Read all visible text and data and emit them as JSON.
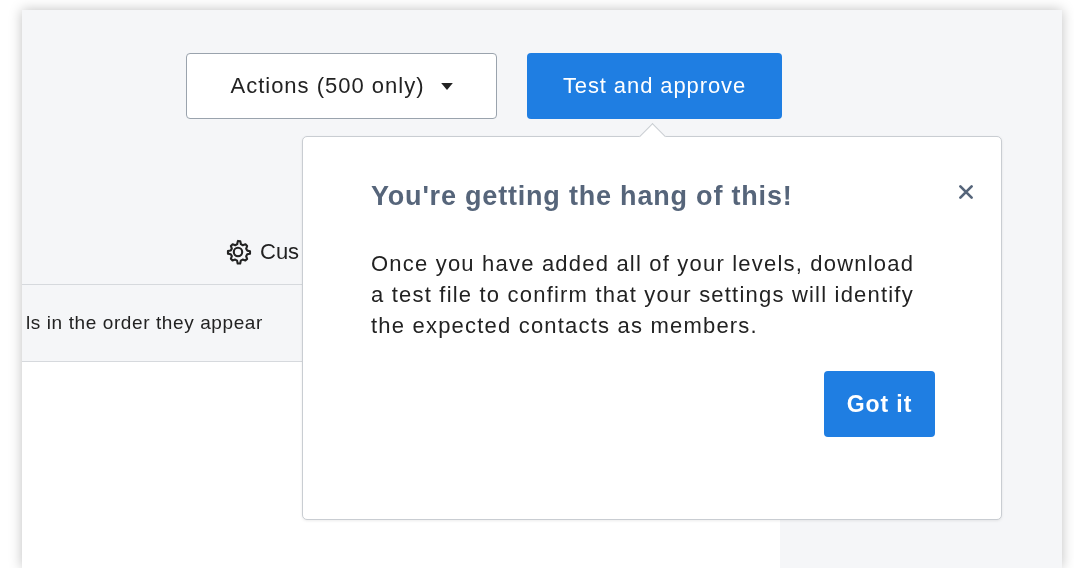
{
  "toolbar": {
    "actions_button": {
      "label": "Actions (500 only)"
    },
    "approve_button": {
      "label": "Test and approve"
    }
  },
  "customize_link": {
    "label": "Cus"
  },
  "instruction_row": {
    "text": "ls in the order they appear"
  },
  "popover": {
    "title": "You're getting the hang of this!",
    "body": "Once you have added all of your levels, download a test file to confirm that your settings will identify the expected contacts as members.",
    "button": "Got it"
  }
}
